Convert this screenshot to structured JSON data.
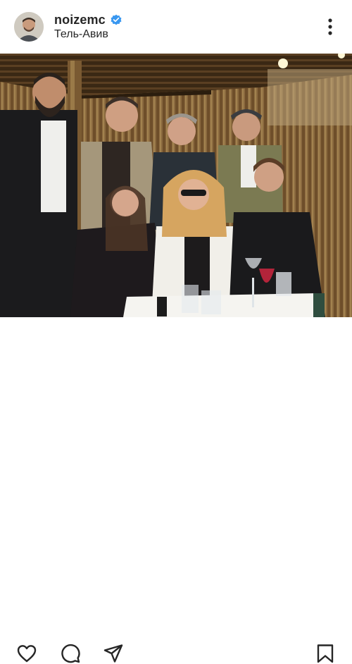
{
  "post": {
    "username": "noizemc",
    "location": "Тель-Авив",
    "verified": true
  },
  "icons": {
    "verified": "verified-badge-icon",
    "more": "more-options-icon",
    "like": "heart-icon",
    "comment": "comment-icon",
    "share": "share-icon",
    "save": "bookmark-icon"
  },
  "colors": {
    "verified_blue": "#3897f0",
    "text": "#262626"
  }
}
